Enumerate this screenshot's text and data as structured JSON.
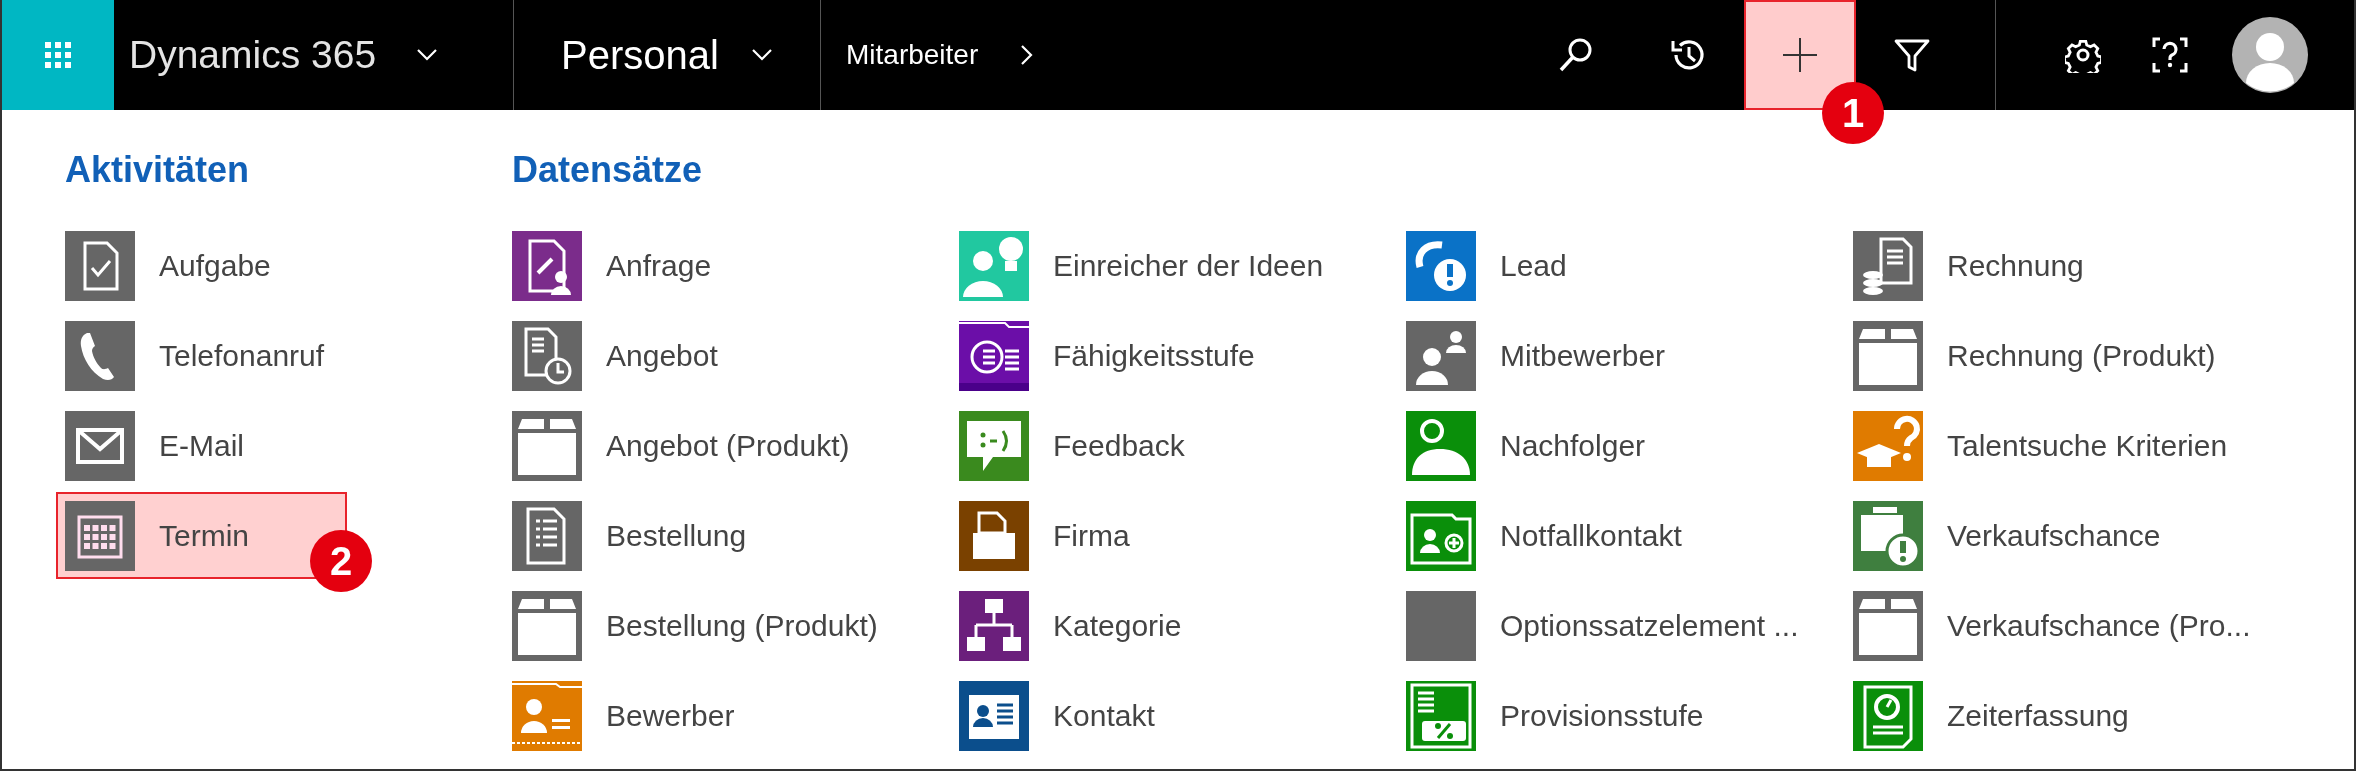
{
  "top_bar": {
    "app_name": "Dynamics 365",
    "area": "Personal",
    "breadcrumb": "Mitarbeiter",
    "actions": [
      {
        "kind": "search",
        "highlighted": false
      },
      {
        "kind": "history",
        "highlighted": false
      },
      {
        "kind": "new",
        "highlighted": true,
        "callout": "1"
      },
      {
        "kind": "filter",
        "highlighted": false
      }
    ],
    "utilities": [
      {
        "kind": "settings"
      },
      {
        "kind": "help"
      },
      {
        "kind": "avatar"
      }
    ]
  },
  "activities": {
    "title": "Aktivitäten",
    "items": [
      {
        "label": "Aufgabe",
        "kind": "task",
        "color": "#666666",
        "highlighted": false
      },
      {
        "label": "Telefonanruf",
        "kind": "phone",
        "color": "#666666",
        "highlighted": false
      },
      {
        "label": "E-Mail",
        "kind": "mail",
        "color": "#666666",
        "highlighted": false
      },
      {
        "label": "Termin",
        "kind": "calendar",
        "color": "#666666",
        "highlighted": true,
        "callout": "2"
      }
    ]
  },
  "records": {
    "title": "Datensätze",
    "items": [
      {
        "label": "Anfrage",
        "kind": "request",
        "color": "#7b2c8b"
      },
      {
        "label": "Angebot",
        "kind": "quote",
        "color": "#666666"
      },
      {
        "label": "Angebot (Produkt)",
        "kind": "box",
        "color": "#666666"
      },
      {
        "label": "Bestellung",
        "kind": "order",
        "color": "#666666"
      },
      {
        "label": "Bestellung (Produkt)",
        "kind": "box",
        "color": "#666666"
      },
      {
        "label": "Bewerber",
        "kind": "applicant",
        "color": "#e07b00"
      },
      {
        "label": "Einreicher der Ideen",
        "kind": "idea",
        "color": "#21c8a0"
      },
      {
        "label": "Fähigkeitsstufe",
        "kind": "skill",
        "color": "#6b0ea8"
      },
      {
        "label": "Feedback",
        "kind": "feedback",
        "color": "#3a8a1e"
      },
      {
        "label": "Firma",
        "kind": "company",
        "color": "#7a4100"
      },
      {
        "label": "Kategorie",
        "kind": "category",
        "color": "#6b1f7c"
      },
      {
        "label": "Kontakt",
        "kind": "contact",
        "color": "#0b4e8c"
      },
      {
        "label": "Lead",
        "kind": "lead",
        "color": "#0a72c7"
      },
      {
        "label": "Mitbewerber",
        "kind": "competitor",
        "color": "#666666"
      },
      {
        "label": "Nachfolger",
        "kind": "successor",
        "color": "#0a8f0a"
      },
      {
        "label": "Notfallkontakt",
        "kind": "emergency",
        "color": "#0a8f0a"
      },
      {
        "label": "Optionssatzelement ...",
        "kind": "blank",
        "color": "#666666"
      },
      {
        "label": "Provisionsstufe",
        "kind": "commission",
        "color": "#0a8f0a"
      },
      {
        "label": "Rechnung",
        "kind": "invoice",
        "color": "#666666"
      },
      {
        "label": "Rechnung (Produkt)",
        "kind": "box",
        "color": "#666666"
      },
      {
        "label": "Talentsuche Kriterien",
        "kind": "talent",
        "color": "#e07b00"
      },
      {
        "label": "Verkaufschance",
        "kind": "opportunity",
        "color": "#3f7f3f"
      },
      {
        "label": "Verkaufschance (Pro...",
        "kind": "box",
        "color": "#666666"
      },
      {
        "label": "Zeiterfassung",
        "kind": "timesheet",
        "color": "#0a8f0a"
      }
    ]
  }
}
